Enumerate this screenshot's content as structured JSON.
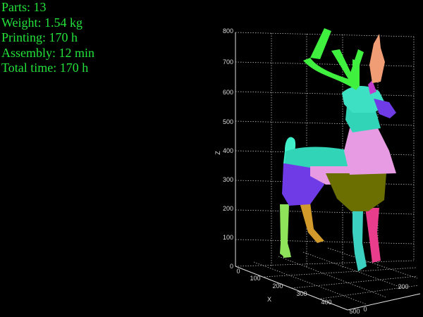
{
  "stats": {
    "parts": "Parts: 13",
    "weight": "Weight: 1.54 kg",
    "printing": "Printing: 170 h",
    "assembly": "Assembly: 12 min",
    "total_time": "Total time: 170 h"
  },
  "plot": {
    "z_axis_label": "Z",
    "x_axis_label": "X",
    "z_ticks": [
      "0",
      "100",
      "200",
      "300",
      "400",
      "500",
      "600",
      "700",
      "800"
    ],
    "x_ticks": [
      "0",
      "100",
      "200",
      "300",
      "400",
      "500"
    ],
    "y_ticks": [
      "0",
      "200"
    ],
    "grid": true
  },
  "model": {
    "part_colors": [
      "#3ff03f",
      "#f09c74",
      "#32d4b8",
      "#6e3be6",
      "#e79be3",
      "#6b6e00",
      "#c03ccc",
      "#8fe35a",
      "#d19a2a",
      "#e83c8c",
      "#5a2ad0",
      "#3bd0c0",
      "#a6a6f0"
    ]
  }
}
